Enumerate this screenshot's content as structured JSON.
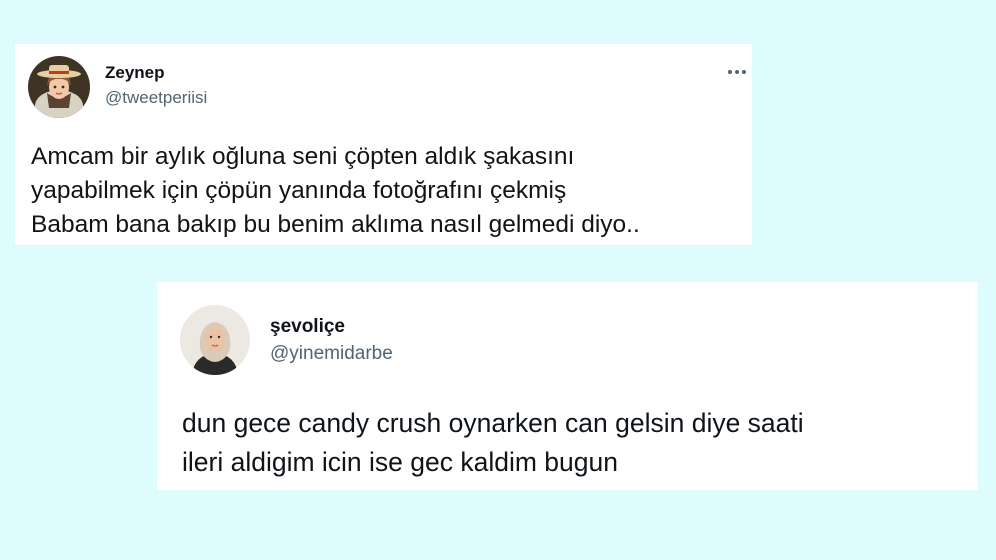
{
  "tweets": [
    {
      "display_name": "Zeynep",
      "handle": "@tweetperiisi",
      "more_icon": "more-horizontal-icon",
      "text_lines": [
        "Amcam bir aylık oğluna seni çöpten aldık şakasını",
        "yapabilmek için çöpün yanında fotoğrafını çekmiş",
        "Babam bana bakıp bu benim aklıma nasıl gelmedi diyo.."
      ]
    },
    {
      "display_name": "şevoliçe",
      "handle": "@yinemidarbe",
      "text_lines": [
        "dun gece candy crush oynarken can gelsin diye saati",
        "ileri aldigim icin ise gec kaldim bugun"
      ]
    }
  ],
  "colors": {
    "page_background": "#defcfd",
    "card_background": "#ffffff",
    "text_primary": "#0f1419",
    "text_secondary": "#536471"
  }
}
